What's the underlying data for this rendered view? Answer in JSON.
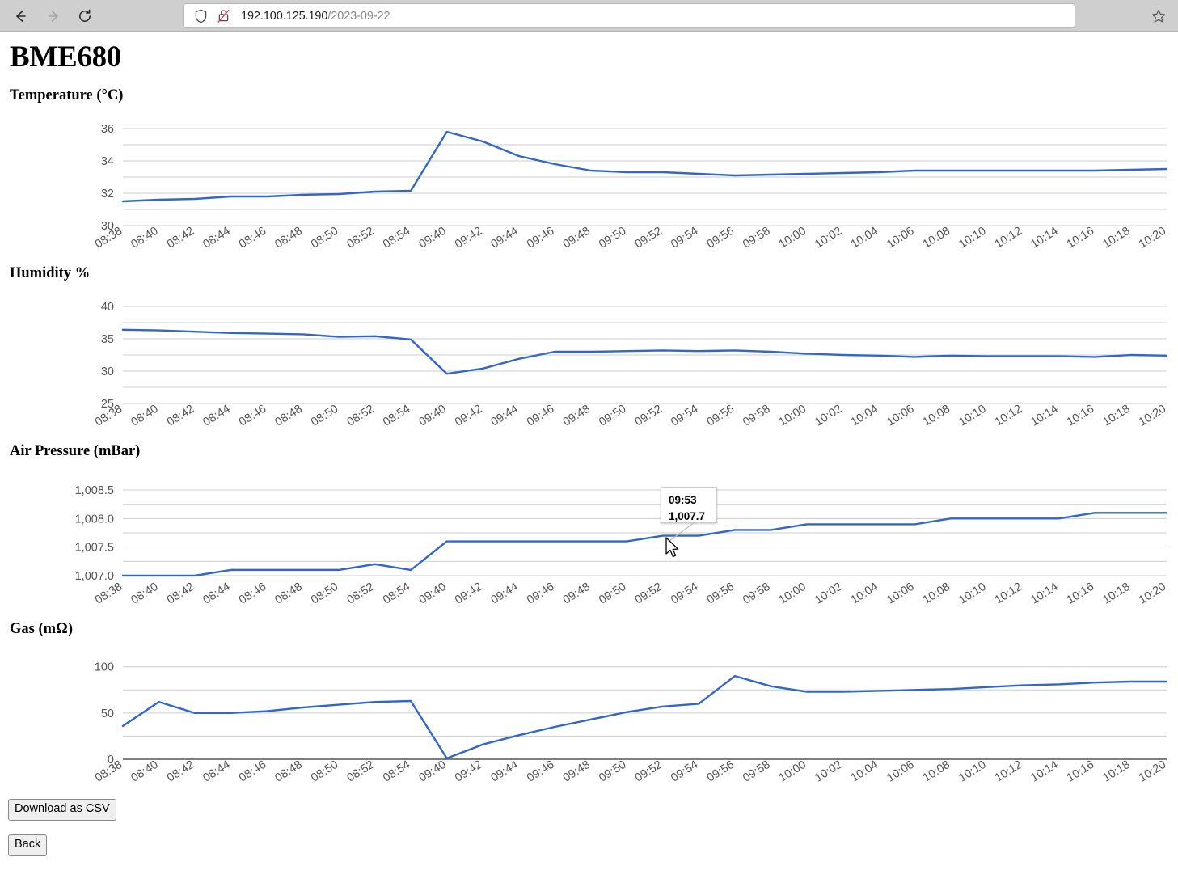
{
  "browser": {
    "back_label": "Back",
    "forward_label": "Forward",
    "reload_label": "Reload",
    "shield_icon": "shield-icon",
    "lock_icon": "lock-crossed-icon",
    "bookmark_icon": "star-icon",
    "url_host": "192.100.125.190",
    "url_path": "/2023-09-22"
  },
  "page": {
    "title": "BME680",
    "download_button": "Download as CSV",
    "back_button": "Back"
  },
  "headings": {
    "temperature": "Temperature (°C)",
    "humidity": "Humidity %",
    "pressure": "Air Pressure (mBar)",
    "gas": "Gas (mΩ)"
  },
  "tooltip": {
    "time": "09:53",
    "value": "1,007.7"
  },
  "style": {
    "line_color": "#3366cc",
    "grid_color": "#cccccc",
    "axis_text_color": "#555555",
    "chrome_bg": "#cfcfcf"
  },
  "chart_data": [
    {
      "type": "line",
      "title": "Temperature (°C)",
      "xlabel": "",
      "ylabel": "Temperature (°C)",
      "ylim": [
        30,
        36
      ],
      "yticks": [
        30,
        32,
        34,
        36
      ],
      "yminor": [
        31,
        33,
        35
      ],
      "grid": true,
      "legend": "none",
      "categories": [
        "08:38",
        "08:40",
        "08:42",
        "08:44",
        "08:46",
        "08:48",
        "08:50",
        "08:52",
        "08:54",
        "09:40",
        "09:42",
        "09:44",
        "09:46",
        "09:48",
        "09:50",
        "09:52",
        "09:54",
        "09:56",
        "09:58",
        "10:00",
        "10:02",
        "10:04",
        "10:06",
        "10:08",
        "10:10",
        "10:12",
        "10:14",
        "10:16",
        "10:18",
        "10:20"
      ],
      "values": [
        31.5,
        31.6,
        31.65,
        31.8,
        31.8,
        31.9,
        31.95,
        32.1,
        32.15,
        35.8,
        35.2,
        34.3,
        33.8,
        33.4,
        33.3,
        33.3,
        33.2,
        33.1,
        33.15,
        33.2,
        33.25,
        33.3,
        33.4,
        33.4,
        33.4,
        33.4,
        33.4,
        33.4,
        33.45,
        33.5
      ]
    },
    {
      "type": "line",
      "title": "Humidity %",
      "xlabel": "",
      "ylabel": "Humidity %",
      "ylim": [
        25,
        40
      ],
      "yticks": [
        25,
        30,
        35,
        40
      ],
      "yminor": [
        27.5,
        32.5,
        37.5
      ],
      "grid": true,
      "legend": "none",
      "categories": [
        "08:38",
        "08:40",
        "08:42",
        "08:44",
        "08:46",
        "08:48",
        "08:50",
        "08:52",
        "08:54",
        "09:40",
        "09:42",
        "09:44",
        "09:46",
        "09:48",
        "09:50",
        "09:52",
        "09:54",
        "09:56",
        "09:58",
        "10:00",
        "10:02",
        "10:04",
        "10:06",
        "10:08",
        "10:10",
        "10:12",
        "10:14",
        "10:16",
        "10:18",
        "10:20"
      ],
      "values": [
        36.4,
        36.3,
        36.1,
        35.9,
        35.8,
        35.7,
        35.3,
        35.4,
        34.9,
        29.6,
        30.4,
        31.9,
        33.0,
        33.0,
        33.1,
        33.2,
        33.1,
        33.2,
        33.0,
        32.7,
        32.5,
        32.4,
        32.2,
        32.4,
        32.3,
        32.3,
        32.3,
        32.2,
        32.5,
        32.4
      ]
    },
    {
      "type": "line",
      "title": "Air Pressure (mBar)",
      "xlabel": "",
      "ylabel": "Air Pressure (mBar)",
      "ylim": [
        1006.9,
        1008.6
      ],
      "yticks": [
        1007.0,
        1007.5,
        1008.0,
        1008.5
      ],
      "ytick_labels": [
        "1,007.0",
        "1,007.5",
        "1,008.0",
        "1,008.5"
      ],
      "yminor": [
        1007.25,
        1007.75,
        1008.25
      ],
      "grid": true,
      "legend": "none",
      "categories": [
        "08:38",
        "08:40",
        "08:42",
        "08:44",
        "08:46",
        "08:48",
        "08:50",
        "08:52",
        "08:54",
        "09:40",
        "09:42",
        "09:44",
        "09:46",
        "09:48",
        "09:50",
        "09:52",
        "09:54",
        "09:56",
        "09:58",
        "10:00",
        "10:02",
        "10:04",
        "10:06",
        "10:08",
        "10:10",
        "10:12",
        "10:14",
        "10:16",
        "10:18",
        "10:20"
      ],
      "values": [
        1007.0,
        1007.0,
        1007.0,
        1007.1,
        1007.1,
        1007.1,
        1007.1,
        1007.2,
        1007.1,
        1007.6,
        1007.6,
        1007.6,
        1007.6,
        1007.6,
        1007.6,
        1007.7,
        1007.7,
        1007.8,
        1007.8,
        1007.9,
        1007.9,
        1007.9,
        1007.9,
        1008.0,
        1008.0,
        1008.0,
        1008.0,
        1008.1,
        1008.1,
        1008.1
      ]
    },
    {
      "type": "line",
      "title": "Gas (mΩ)",
      "xlabel": "",
      "ylabel": "Gas (mΩ)",
      "ylim": [
        0,
        105
      ],
      "yticks": [
        0,
        50,
        100
      ],
      "yminor": [
        25,
        75
      ],
      "grid": true,
      "legend": "none",
      "categories": [
        "08:38",
        "08:40",
        "08:42",
        "08:44",
        "08:46",
        "08:48",
        "08:50",
        "08:52",
        "08:54",
        "09:40",
        "09:42",
        "09:44",
        "09:46",
        "09:48",
        "09:50",
        "09:52",
        "09:54",
        "09:56",
        "09:58",
        "10:00",
        "10:02",
        "10:04",
        "10:06",
        "10:08",
        "10:10",
        "10:12",
        "10:14",
        "10:16",
        "10:18",
        "10:20"
      ],
      "values": [
        36,
        62,
        50,
        50,
        52,
        56,
        59,
        62,
        63,
        1,
        16,
        26,
        35,
        43,
        51,
        57,
        60,
        90,
        79,
        73,
        73,
        74,
        75,
        76,
        78,
        80,
        81,
        83,
        84,
        84
      ]
    }
  ]
}
